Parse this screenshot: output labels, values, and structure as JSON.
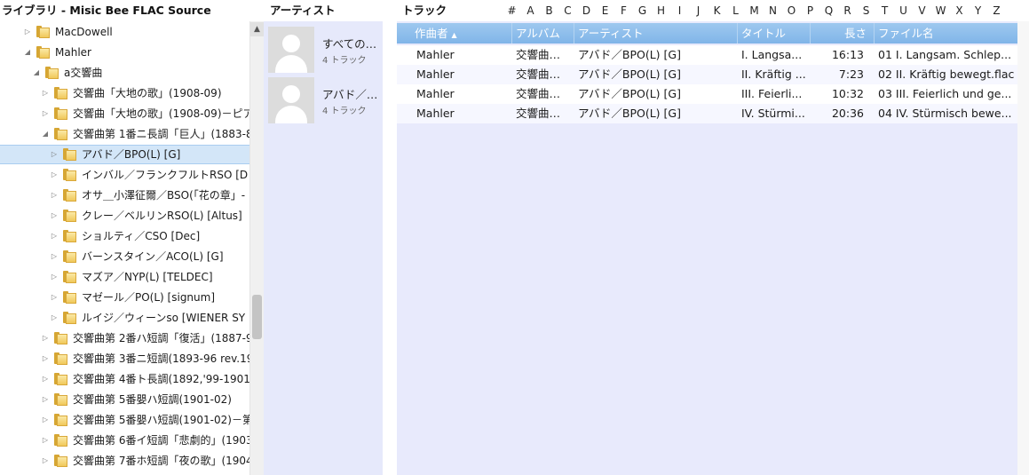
{
  "header": {
    "library_title": "ライブラリ - Misic Bee FLAC Source",
    "artist_col_title": "アーティスト",
    "track_col_title": "トラック",
    "alpha": [
      "#",
      "A",
      "B",
      "C",
      "D",
      "E",
      "F",
      "G",
      "H",
      "I",
      "J",
      "K",
      "L",
      "M",
      "N",
      "O",
      "P",
      "Q",
      "R",
      "S",
      "T",
      "U",
      "V",
      "W",
      "X",
      "Y",
      "Z"
    ]
  },
  "tree": [
    {
      "label": "MacDowell",
      "expanded": false
    },
    {
      "label": "Mahler",
      "expanded": true
    },
    {
      "label": "a交響曲",
      "expanded": true
    },
    {
      "label": "交響曲「大地の歌」(1908-09)",
      "expanded": false
    },
    {
      "label": "交響曲「大地の歌」(1908-09)－ピア",
      "expanded": false
    },
    {
      "label": "交響曲第 1番ニ長調「巨人」(1883-8",
      "expanded": true
    },
    {
      "label": "アバド／BPO(L) [G]",
      "expanded": false,
      "selected": true
    },
    {
      "label": "インバル／フランクフルトRSO [D",
      "expanded": false
    },
    {
      "label": "オサ＿小澤征爾／BSO(「花の章」-",
      "expanded": false
    },
    {
      "label": "クレー／ベルリンRSO(L) [Altus]",
      "expanded": false
    },
    {
      "label": "ショルティ／CSO [Dec]",
      "expanded": false
    },
    {
      "label": "バーンスタイン／ACO(L) [G]",
      "expanded": false
    },
    {
      "label": "マズア／NYP(L) [TELDEC]",
      "expanded": false
    },
    {
      "label": "マゼール／PO(L) [signum]",
      "expanded": false
    },
    {
      "label": "ルイジ／ウィーンso [WIENER SY",
      "expanded": false
    },
    {
      "label": "交響曲第 2番ハ短調「復活」(1887-9",
      "expanded": false
    },
    {
      "label": "交響曲第 3番ニ短調(1893-96 rev.19",
      "expanded": false
    },
    {
      "label": "交響曲第 4番ト長調(1892,'99-1901",
      "expanded": false
    },
    {
      "label": "交響曲第 5番嬰ハ短調(1901-02)",
      "expanded": false
    },
    {
      "label": "交響曲第 5番嬰ハ短調(1901-02)－第",
      "expanded": false
    },
    {
      "label": "交響曲第 6番イ短調「悲劇的」(1903",
      "expanded": false
    },
    {
      "label": "交響曲第 7番ホ短調「夜の歌」(1904",
      "expanded": false
    }
  ],
  "artists": [
    {
      "name": "すべての…",
      "count": "4 トラック"
    },
    {
      "name": "アバド／…",
      "count": "4 トラック"
    }
  ],
  "columns": {
    "composer": "作曲者",
    "album": "アルバム",
    "artist": "アーティスト",
    "title": "タイトル",
    "length": "長さ",
    "filename": "ファイル名"
  },
  "rows": [
    {
      "composer": "Mahler",
      "album": "交響曲…",
      "artist": "アバド／BPO(L) [G]",
      "title": "I. Langsa...",
      "length": "16:13",
      "filename": "01 I. Langsam. Schlep..."
    },
    {
      "composer": "Mahler",
      "album": "交響曲…",
      "artist": "アバド／BPO(L) [G]",
      "title": "II. Kräftig ...",
      "length": "7:23",
      "filename": "02 II. Kräftig bewegt.flac"
    },
    {
      "composer": "Mahler",
      "album": "交響曲…",
      "artist": "アバド／BPO(L) [G]",
      "title": "III. Feierli...",
      "length": "10:32",
      "filename": "03 III. Feierlich und ge..."
    },
    {
      "composer": "Mahler",
      "album": "交響曲…",
      "artist": "アバド／BPO(L) [G]",
      "title": "IV. Stürmi...",
      "length": "20:36",
      "filename": "04 IV. Stürmisch bewe..."
    }
  ],
  "colors": {
    "header_gradient_top": "#9ec8ef",
    "header_gradient_bottom": "#80b5e8",
    "selection": "#d3e6f8",
    "panel_background": "#e6e9fb"
  }
}
